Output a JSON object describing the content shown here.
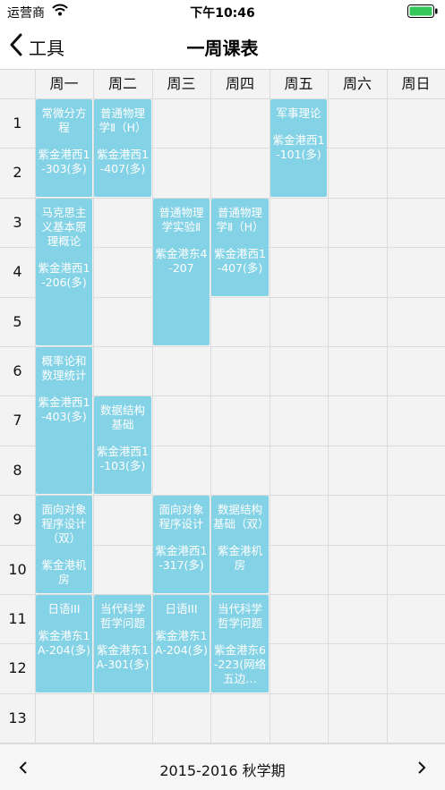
{
  "status_bar": {
    "carrier": "运营商",
    "time": "下午10:46"
  },
  "nav": {
    "back_label": "工具",
    "title": "一周课表"
  },
  "days": [
    "周一",
    "周二",
    "周三",
    "周四",
    "周五",
    "周六",
    "周日"
  ],
  "periods": [
    "1",
    "2",
    "3",
    "4",
    "5",
    "6",
    "7",
    "8",
    "9",
    "10",
    "11",
    "12",
    "13"
  ],
  "courses": [
    {
      "name": "常微分方程",
      "room": "紫金港西1-303(多)",
      "day": 1,
      "start": 1,
      "end": 2
    },
    {
      "name": "普通物理学Ⅱ（H）",
      "room": "紫金港西1-407(多)",
      "day": 2,
      "start": 1,
      "end": 2
    },
    {
      "name": "军事理论",
      "room": "紫金港西1-101(多)",
      "day": 5,
      "start": 1,
      "end": 2
    },
    {
      "name": "马克思主义基本原理概论",
      "room": "紫金港西1-206(多)",
      "day": 1,
      "start": 3,
      "end": 5
    },
    {
      "name": "普通物理学实验Ⅱ",
      "room": "紫金港东4-207",
      "day": 3,
      "start": 3,
      "end": 5
    },
    {
      "name": "普通物理学Ⅱ（H）",
      "room": "紫金港西1-407(多)",
      "day": 4,
      "start": 3,
      "end": 4
    },
    {
      "name": "概率论和数理统计",
      "room": "紫金港西1-403(多)",
      "day": 1,
      "start": 6,
      "end": 8
    },
    {
      "name": "数据结构基础",
      "room": "紫金港西1-103(多)",
      "day": 2,
      "start": 7,
      "end": 8
    },
    {
      "name": "面向对象程序设计（双）",
      "room": "紫金港机房",
      "day": 1,
      "start": 9,
      "end": 10
    },
    {
      "name": "面向对象程序设计",
      "room": "紫金港西1-317(多)",
      "day": 3,
      "start": 9,
      "end": 10
    },
    {
      "name": "数据结构基础（双）",
      "room": "紫金港机房",
      "day": 4,
      "start": 9,
      "end": 10
    },
    {
      "name": "日语III",
      "room": "紫金港东1A-204(多)",
      "day": 1,
      "start": 11,
      "end": 12
    },
    {
      "name": "当代科学哲学问题",
      "room": "紫金港东1A-301(多)",
      "day": 2,
      "start": 11,
      "end": 12
    },
    {
      "name": "日语III",
      "room": "紫金港东1A-204(多)",
      "day": 3,
      "start": 11,
      "end": 12
    },
    {
      "name": "当代科学哲学问题",
      "room": "紫金港东6-223(网络五边…",
      "day": 4,
      "start": 11,
      "end": 12
    }
  ],
  "footer": {
    "term": "2015-2016 秋学期"
  },
  "colors": {
    "course_bg": "#83d2e5",
    "grid_bg": "#f3f3f3",
    "grid_line": "#dcdcdc"
  },
  "icons": {
    "back": "chevron-left-icon",
    "prev": "chevron-left-icon",
    "next": "chevron-right-icon",
    "wifi": "wifi-icon",
    "battery": "battery-icon"
  }
}
